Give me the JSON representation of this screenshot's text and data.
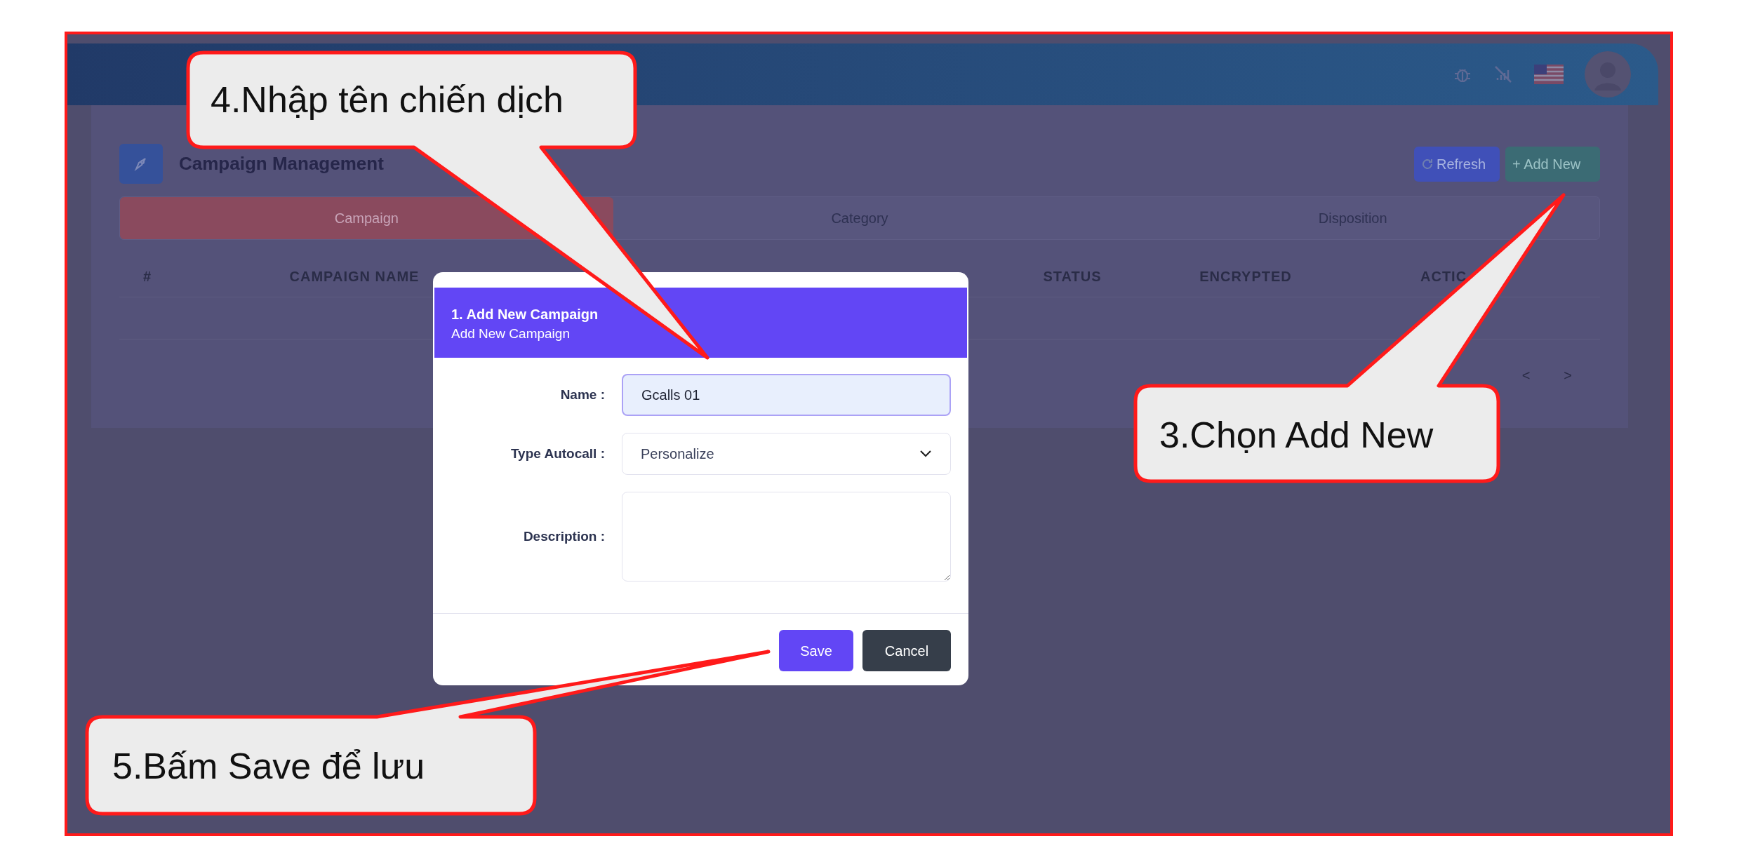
{
  "page_header": {
    "title": "Campaign Management",
    "buttons": [
      {
        "kind": "refresh",
        "label": "Refresh"
      },
      {
        "kind": "add",
        "label": "+ Add New"
      }
    ]
  },
  "tabs": [
    {
      "label": "Campaign",
      "selected": true
    },
    {
      "label": "Category",
      "selected": false
    },
    {
      "label": "Disposition",
      "selected": false
    }
  ],
  "table": {
    "columns": [
      "#",
      "CAMPAIGN NAME",
      "STATUS",
      "ENCRYPTED",
      "ACTIC"
    ]
  },
  "pagination": {
    "prev": "<",
    "next": ">"
  },
  "modal": {
    "title": "1. Add New Campaign",
    "subtitle": "Add New Campaign",
    "fields": [
      {
        "kind": "text",
        "label": "Name :",
        "value": "Gcalls 01"
      },
      {
        "kind": "select",
        "label": "Type Autocall :",
        "value": "Personalize"
      },
      {
        "kind": "textarea",
        "label": "Description :"
      }
    ],
    "buttons": [
      {
        "kind": "primary",
        "label": "Save"
      },
      {
        "kind": "secondary",
        "label": "Cancel"
      }
    ]
  },
  "callouts": [
    {
      "text": "4.Nhập tên chiến dịch"
    },
    {
      "text": "3.Chọn Add New"
    },
    {
      "text": "5.Bấm Save để lưu"
    }
  ]
}
